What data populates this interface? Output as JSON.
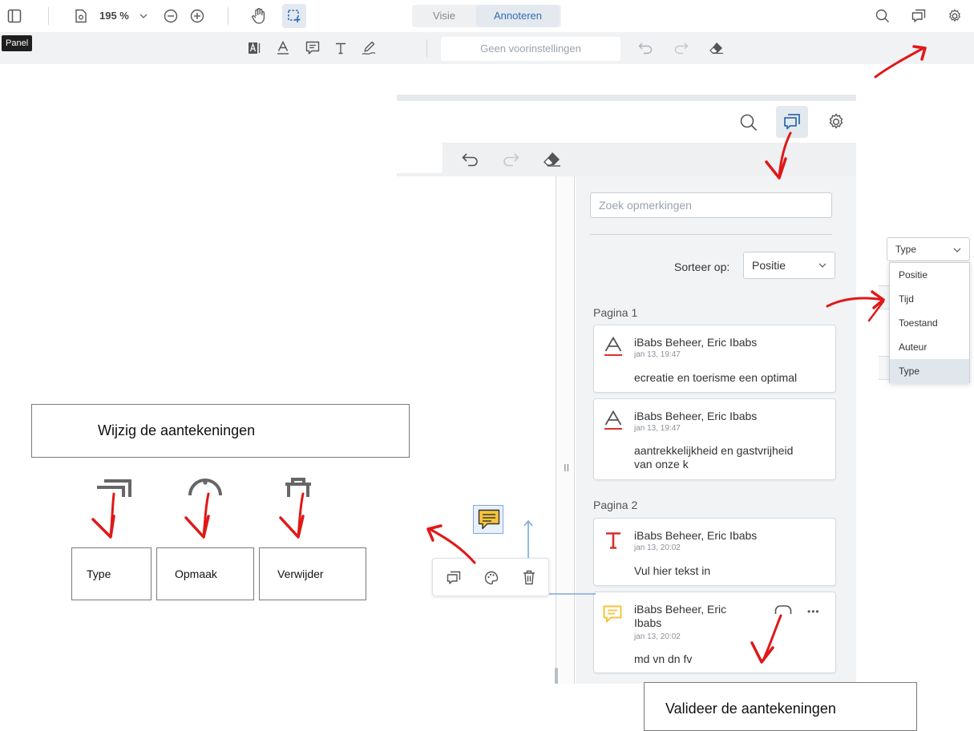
{
  "top_toolbar": {
    "zoom": "195 %",
    "modes": {
      "view": "Visie",
      "annotate": "Annoteren"
    },
    "tooltip": "Panel"
  },
  "annot_toolbar": {
    "preset_placeholder": "Geen voorinstellingen"
  },
  "panel": {
    "search_placeholder": "Zoek opmerkingen",
    "sort_label": "Sorteer op:",
    "sort_value": "Positie",
    "pages": [
      "Pagina 1",
      "Pagina 2"
    ],
    "comments": [
      {
        "author": "iBabs Beheer, Eric Ibabs",
        "time": "jan 13, 19:47",
        "body": "ecreatie en toerisme een optimal",
        "icon": "underline-icon"
      },
      {
        "author": "iBabs Beheer, Eric Ibabs",
        "time": "jan 13, 19:47",
        "body": "aantrekkelijkheid en gastvrijheid van onze k",
        "icon": "underline-icon"
      },
      {
        "author": "iBabs Beheer, Eric Ibabs",
        "time": "jan 13, 20:02",
        "body": "Vul hier tekst in",
        "icon": "free-text-icon"
      },
      {
        "author": "iBabs Beheer, Eric Ibabs",
        "time": "jan 13, 20:02",
        "body": "md vn dn fv",
        "icon": "note-icon"
      }
    ],
    "more_label": "•••"
  },
  "type_dropdown": {
    "value": "Type",
    "options": [
      "Positie",
      "Tijd",
      "Toestand",
      "Auteur",
      "Type"
    ],
    "selected": "Type"
  },
  "annotations": {
    "edit_title": "Wijzig de aantekeningen",
    "type_label": "Type",
    "style_label": "Opmaak",
    "delete_label": "Verwijder",
    "validate_title": "Valideer de aantekeningen"
  },
  "colors": {
    "accent": "#2f6db3",
    "arrow_red": "#e01818",
    "note_yellow": "#f6c33b",
    "text_red": "#d9302c"
  }
}
